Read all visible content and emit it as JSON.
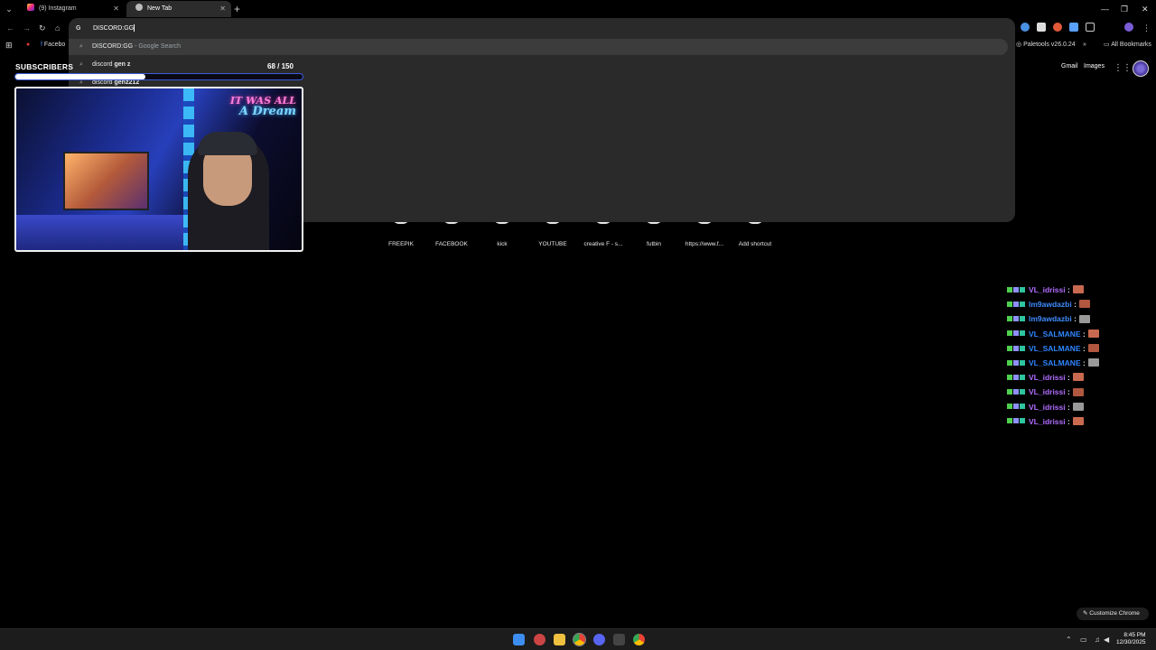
{
  "tabs": [
    {
      "title": "(9) Instagram",
      "close": "✕"
    },
    {
      "title": "New Tab",
      "close": "✕"
    }
  ],
  "new_tab_symbol": "+",
  "window_controls": {
    "minimize": "—",
    "maximize": "❐",
    "close": "✕"
  },
  "omnibox": {
    "query": "DISCORD:GG",
    "suggestions": [
      {
        "text": "DISCORD:GG",
        "hint": " - Google Search"
      },
      {
        "prefix": "discord ",
        "bold": "gen z"
      },
      {
        "prefix": "discord ",
        "bold": "genz212"
      }
    ]
  },
  "bookmarks": {
    "items": [
      {
        "label": "Facebo"
      }
    ],
    "extension": "Paletools v26.0.24",
    "all_bookmarks": "All Bookmarks"
  },
  "google": {
    "links": [
      "Gmail",
      "Images"
    ],
    "shortcuts": [
      {
        "label": "FREEPIK"
      },
      {
        "label": "FACEBOOK"
      },
      {
        "label": "kick"
      },
      {
        "label": "YOUTUBE"
      },
      {
        "label": "creative F - s..."
      },
      {
        "label": "futbin"
      },
      {
        "label": "https://www.f..."
      },
      {
        "label": "Add shortcut"
      }
    ],
    "customize_label": "Customize Chrome"
  },
  "overlay": {
    "subscribers_label": "SUBSCRIBERS",
    "count": "68",
    "goal": "/ 150",
    "progress_fraction": 0.453,
    "neon_sign_line1": "IT WAS ALL",
    "neon_sign_line2": "A Dream"
  },
  "chat": [
    {
      "user": "VL_idrissi",
      "color": "#b06cff"
    },
    {
      "user": "lm9awdazbi",
      "color": "#3f8dff"
    },
    {
      "user": "lm9awdazbi",
      "color": "#3f8dff"
    },
    {
      "user": "VL_SALMANE",
      "color": "#2f86ff"
    },
    {
      "user": "VL_SALMANE",
      "color": "#2f86ff"
    },
    {
      "user": "VL_SALMANE",
      "color": "#2f86ff"
    },
    {
      "user": "VL_idrissi",
      "color": "#b06cff"
    },
    {
      "user": "VL_idrissi",
      "color": "#b06cff"
    },
    {
      "user": "VL_idrissi",
      "color": "#b06cff"
    },
    {
      "user": "VL_idrissi",
      "color": "#b06cff"
    }
  ],
  "chat_separator": " :",
  "taskbar": {
    "time": "8:45 PM",
    "date": "12/30/2025"
  }
}
